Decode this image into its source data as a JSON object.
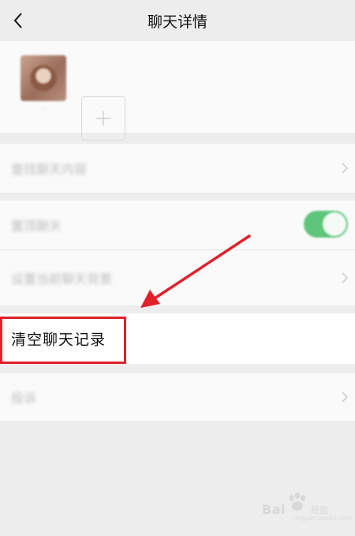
{
  "header": {
    "title": "聊天详情"
  },
  "members": {
    "member_name": "···"
  },
  "settings": {
    "rows": [
      {
        "label": "查找聊天内容"
      },
      {
        "label": "置顶聊天"
      },
      {
        "label": "设置当前聊天背景"
      },
      {
        "label": "清空聊天记录"
      },
      {
        "label": "投诉"
      }
    ],
    "pin_chat_toggle_on": true
  },
  "annotation": {
    "color": "#e0212b"
  },
  "watermark": {
    "brand": "Bai",
    "brand2": "经验",
    "url": "jingyan.baidu.com"
  }
}
